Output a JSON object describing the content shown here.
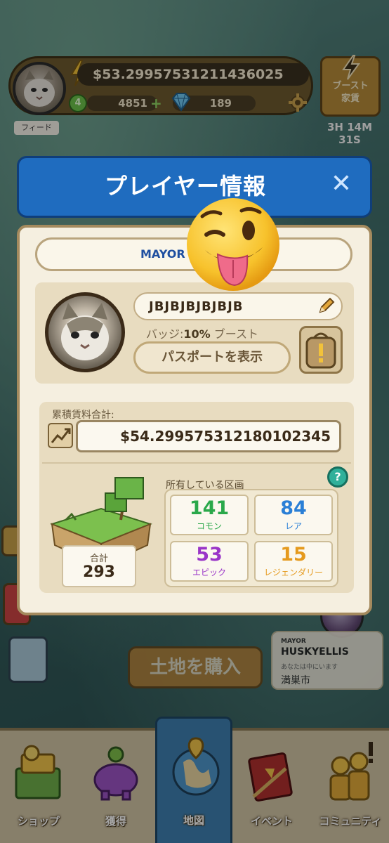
{
  "hud": {
    "money": "$53.29957531211436025",
    "level": "4",
    "coins": "4851",
    "gems": "189",
    "boost_label": "ブースト\n家賃",
    "boost_timer": "3H 14M 31S",
    "feed_tab": "フィード"
  },
  "dialog": {
    "title": "プレイヤー情報",
    "close": "✕",
    "rank": "MAYOR",
    "player_name": "JBJBJBJBJBJB",
    "badge_prefix": "バッジ:",
    "badge_value": "10%",
    "badge_suffix": " ブースト",
    "passport_button": "パスポートを表示",
    "earnings_label": "累積賃料合計:",
    "earnings_value": "$54.299575312180102345",
    "owned_label": "所有している区画",
    "help": "?",
    "total_label": "合計",
    "total_value": "293",
    "tiles": [
      {
        "count": "141",
        "label": "コモン",
        "color": "#2aa84a"
      },
      {
        "count": "84",
        "label": "レア",
        "color": "#2a7fd6"
      },
      {
        "count": "53",
        "label": "エピック",
        "color": "#9a35c8"
      },
      {
        "count": "15",
        "label": "レジェンダリー",
        "color": "#e59a1e"
      }
    ]
  },
  "background": {
    "buy_button": "土地を購入",
    "mayor_card": {
      "title": "MAYOR",
      "name": "HUSKYELLIS",
      "sub": "あなたは中にいます",
      "city": "満巣市"
    }
  },
  "nav": [
    {
      "label": "ショップ",
      "icon": "shop-icon"
    },
    {
      "label": "獲得",
      "icon": "piggy-bank-icon"
    },
    {
      "label": "地図",
      "icon": "map-icon"
    },
    {
      "label": "イベント",
      "icon": "event-book-icon"
    },
    {
      "label": "コミュニティ",
      "icon": "community-icon"
    }
  ],
  "colors": {
    "dialog_header": "#1f6cbf",
    "dialog_body": "#f5efe0",
    "nav_active": "#3e7fb0"
  }
}
